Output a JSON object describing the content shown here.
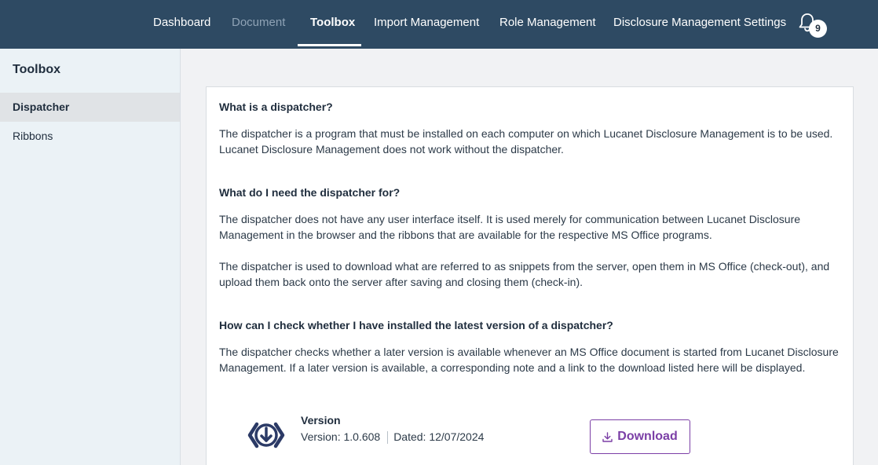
{
  "nav": {
    "items": [
      {
        "label": "Dashboard"
      },
      {
        "label": "Document"
      },
      {
        "label": "Toolbox"
      },
      {
        "label": "Import Management"
      },
      {
        "label": "Role Management"
      },
      {
        "label": "Disclosure Management Settings"
      }
    ],
    "active": "Toolbox",
    "disabled": "Document",
    "notifications_count": "9",
    "bell_icon": "bell-icon"
  },
  "sidebar": {
    "title": "Toolbox",
    "items": [
      {
        "label": "Dispatcher",
        "selected": true
      },
      {
        "label": "Ribbons",
        "selected": false
      }
    ]
  },
  "content": {
    "sections": [
      {
        "question": "What is a dispatcher?",
        "paragraphs": [
          "The dispatcher is a program that must be installed on each computer on which Lucanet Disclosure Management is to be used. Lucanet Disclosure Management does not work without the dispatcher."
        ]
      },
      {
        "question": "What do I need the dispatcher for?",
        "paragraphs": [
          "The dispatcher does not have any user interface itself. It is used merely for communication between Lucanet Disclosure Management in the browser and the ribbons that are available for the respective MS Office programs.",
          "The dispatcher is used to download what are referred to as snippets from the server, open them in MS Office (check-out), and upload them back onto the server after saving and closing them (check-in)."
        ]
      },
      {
        "question": "How can I check whether I have installed the latest version of a dispatcher?",
        "paragraphs": [
          "The dispatcher checks whether a later version is available whenever an MS Office document is started from Lucanet Disclosure Management. If a later version is available, a corresponding note and a link to the download listed here will be displayed."
        ]
      }
    ],
    "download": {
      "title": "Version",
      "version": "Version: 1.0.608",
      "dated": "Dated: 12/07/2024",
      "button_label": "Download",
      "icon": "download-icon",
      "brand_icon": "dispatcher-logo-icon"
    }
  },
  "colors": {
    "topbar": "#2e4a63",
    "sidebar": "#ebf2f6",
    "accent": "#7b3fa6",
    "logo": "#2b3a66"
  }
}
